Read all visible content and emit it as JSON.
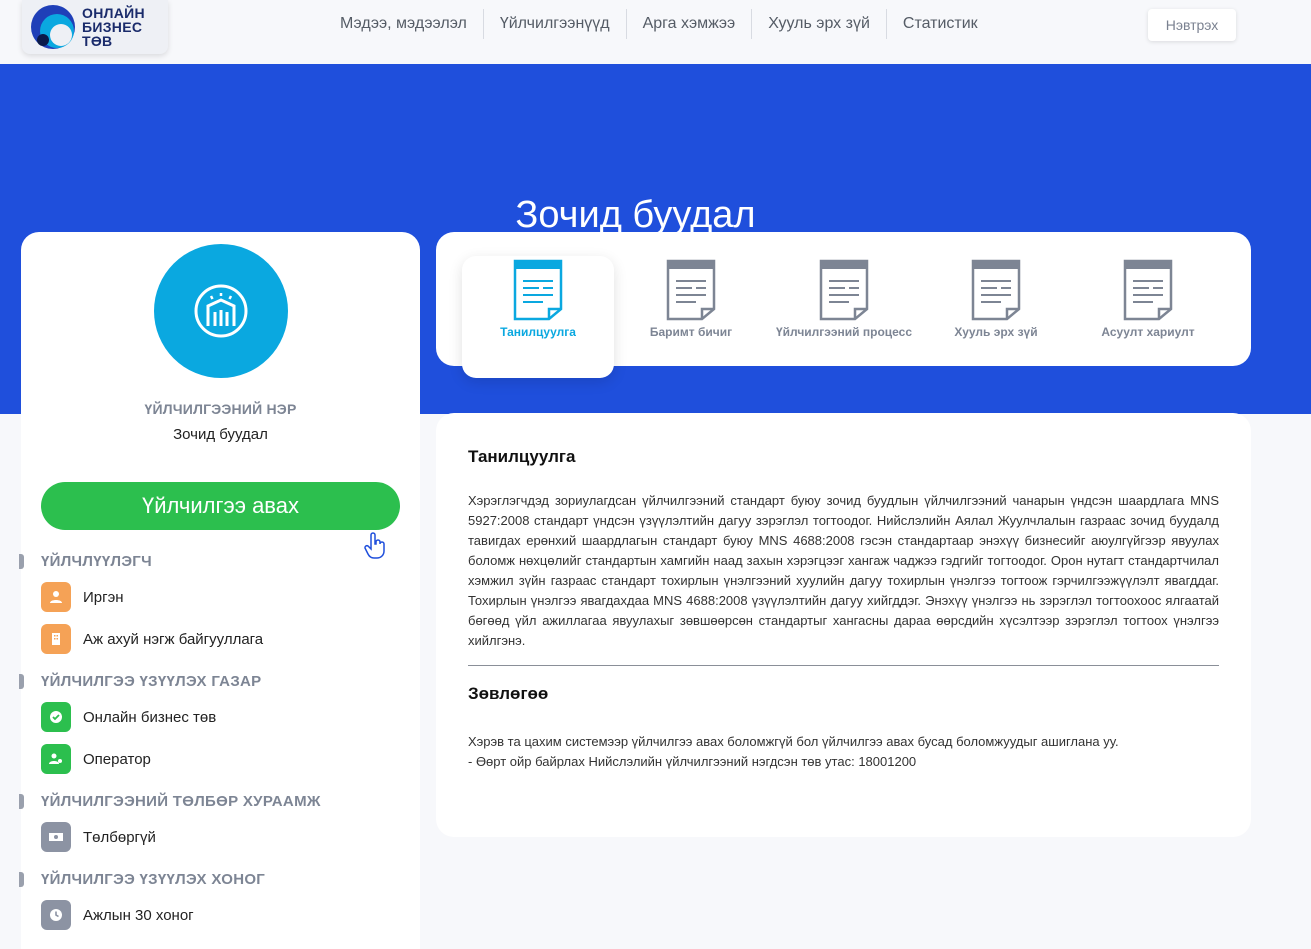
{
  "header": {
    "logo_lines": [
      "ОНЛАЙН",
      "БИЗНЕС",
      "ТӨВ"
    ],
    "nav": [
      "Мэдээ, мэдээлэл",
      "Үйлчилгээнүүд",
      "Арга хэмжээ",
      "Хууль эрх зүй",
      "Статистик"
    ],
    "login_label": "Нэвтрэх"
  },
  "hero": {
    "title": "Зочид буудал"
  },
  "service": {
    "name_label": "ҮЙЛЧИЛГЭЭНИЙ НЭР",
    "name_value": "Зочид буудал",
    "get_service_label": "Үйлчилгээ авах"
  },
  "sections": {
    "provider": {
      "title": "ҮЙЛЧЛҮҮЛЭГЧ",
      "items": [
        "Иргэн",
        "Аж ахуй нэгж байгууллага"
      ]
    },
    "location": {
      "title": "ҮЙЛЧИЛГЭЭ ҮЗҮҮЛЭХ ГАЗАР",
      "items": [
        "Онлайн бизнес төв",
        "Оператор"
      ]
    },
    "fee": {
      "title": "ҮЙЛЧИЛГЭЭНИЙ ТӨЛБӨР ХУРААМЖ",
      "items": [
        "Төлбөргүй"
      ]
    },
    "duration": {
      "title": "ҮЙЛЧИЛГЭЭ ҮЗҮҮЛЭХ ХОНОГ",
      "items": [
        "Ажлын 30 хоног"
      ]
    }
  },
  "tabs": [
    {
      "label": "Танилцуулга",
      "active": true
    },
    {
      "label": "Баримт бичиг",
      "active": false
    },
    {
      "label": "Үйлчилгээний процесс",
      "active": false
    },
    {
      "label": "Хууль эрх зүй",
      "active": false
    },
    {
      "label": "Асуулт хариулт",
      "active": false
    }
  ],
  "content": {
    "intro_heading": "Танилцуулга",
    "intro_text": "Хэрэглэгчдэд зориулагдсан үйлчилгээний стандарт буюу зочид буудлын үйлчилгээний чанарын үндсэн шаардлага MNS 5927:2008 стандарт үндсэн үзүүлэлтийн дагуу зэрэглэл тогтоодог. Нийслэлийн Аялал Жуулчлалын газраас зочид буудалд тавигдах ерөнхий шаардлагын стандарт буюу MNS 4688:2008 гэсэн стандартаар энэхүү бизнесийг аюулгүйгээр явуулах боломж нөхцөлийг стандартын хамгийн наад захын хэрэгцээг хангаж чаджээ гэдгийг тогтоодог. Орон нутагт стандартчилал хэмжил зүйн газраас стандарт тохирлын үнэлгээний хуулийн дагуу тохирлын үнэлгээ тогтоож гэрчилгээжүүлэлт явагддаг. Тохирлын үнэлгээ явагдахдаа MNS 4688:2008 үзүүлэлтийн дагуу хийгддэг. Энэхүү үнэлгээ нь зэрэглэл тогтоохоос ялгаатай бөгөөд үйл ажиллагаа явуулахыг зөвшөөрсөн стандартыг хангасны дараа өөрсдийн хүсэлтээр зэрэглэл тогтоох үнэлгээ хийлгэнэ.",
    "advice_heading": "Зөвлөгөө",
    "advice_line1": "Хэрэв та цахим системээр үйлчилгээ авах боломжгүй бол үйлчилгээ авах бусад боломжуудыг ашиглана уу.",
    "advice_line2": "- Өөрт ойр байрлах Нийслэлийн үйлчилгээний нэгдсэн төв утас: 18001200"
  },
  "colors": {
    "hero_blue": "#1f4fdc",
    "accent_cyan": "#0aa8e0",
    "button_green": "#2cbf4e",
    "orange_icon": "#f5a256",
    "grey_icon": "#8c93a3"
  }
}
